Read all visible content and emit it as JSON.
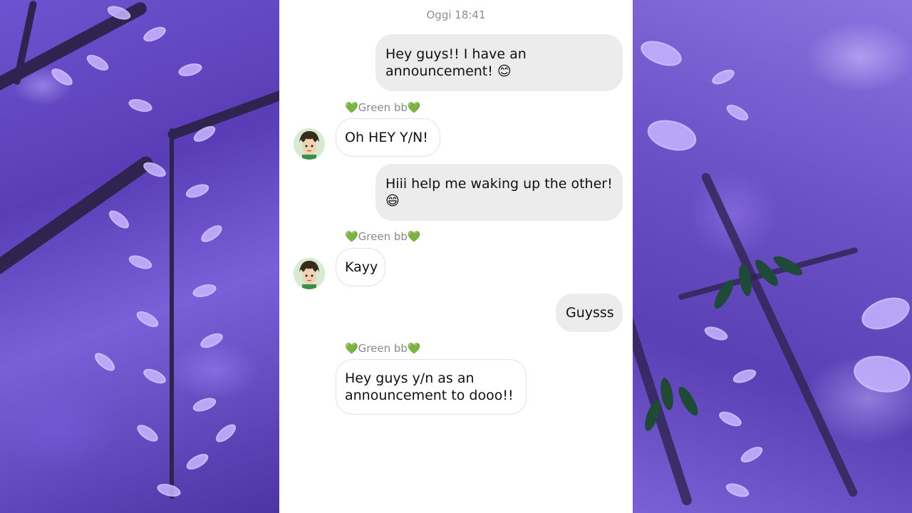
{
  "chat": {
    "timestamp": "Oggi 18:41",
    "messages": [
      {
        "direction": "out",
        "text": "Hey guys!! I have an announcement! 😊"
      },
      {
        "direction": "in",
        "sender": "💚Green bb💚",
        "text": "Oh HEY Y/N!"
      },
      {
        "direction": "out",
        "text": "Hiii help me waking up the other! 😄"
      },
      {
        "direction": "in",
        "sender": "💚Green bb💚",
        "text": "Kayy"
      },
      {
        "direction": "out",
        "text": "Guysss"
      },
      {
        "direction": "in",
        "sender": "💚Green bb💚",
        "text": "Hey guys y/n as an announcement to dooo!!"
      }
    ]
  },
  "colors": {
    "outgoing_bubble": "#ececec",
    "incoming_bubble": "#ffffff",
    "background_accent": "#6f52cf"
  }
}
